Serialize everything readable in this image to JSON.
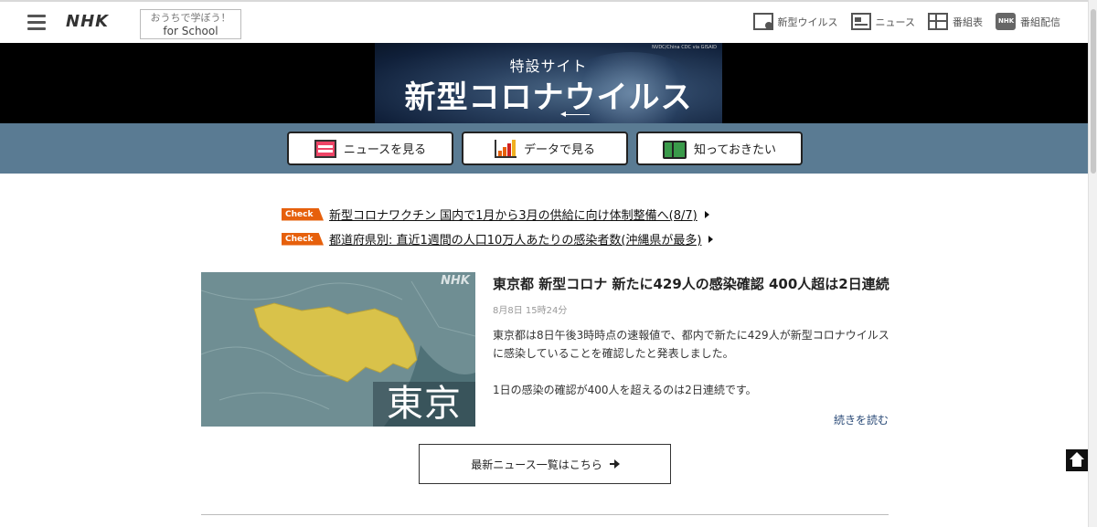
{
  "header": {
    "logo": "NHK",
    "school_line1": "おうちで学ぼう！",
    "school_line2": "for School",
    "nav": [
      {
        "label": "新型ウイルス",
        "icon": "virus-icon"
      },
      {
        "label": "ニュース",
        "icon": "news-icon"
      },
      {
        "label": "番組表",
        "icon": "program-table-icon"
      },
      {
        "label": "番組配信",
        "icon": "streaming-icon"
      }
    ]
  },
  "banner": {
    "credit": "NVDC/China CDC via GISAID",
    "subtitle": "特設サイト",
    "title": "新型コロナウイルス"
  },
  "actions": [
    {
      "label": "ニュースを見る",
      "icon": "news-icon"
    },
    {
      "label": "データで見る",
      "icon": "bar-chart-icon"
    },
    {
      "label": "知っておきたい",
      "icon": "book-icon"
    }
  ],
  "checks": [
    {
      "tag": "Check",
      "text": "新型コロナワクチン 国内で1月から3月の供給に向け体制整備へ(8/7)"
    },
    {
      "tag": "Check",
      "text": "都道府県別: 直近1週間の人口10万人あたりの感染者数(沖縄県が最多)"
    }
  ],
  "article": {
    "image_logo": "NHK",
    "image_label": "東京",
    "title": "東京都 新型コロナ 新たに429人の感染確認 400人超は2日連続",
    "date": "8月8日 15時24分",
    "body1": "東京都は8日午後3時時点の速報値で、都内で新たに429人が新型コロナウイルスに感染していることを確認したと発表しました。",
    "body2": "1日の感染の確認が400人を超えるのは2日連続です。",
    "read_more": "続きを読む"
  },
  "more_button": "最新ニュース一覧はこちら",
  "colors": {
    "band": "#5a7b93",
    "check_tag": "#e6600c",
    "tokyo_highlight": "#d9c24a"
  }
}
